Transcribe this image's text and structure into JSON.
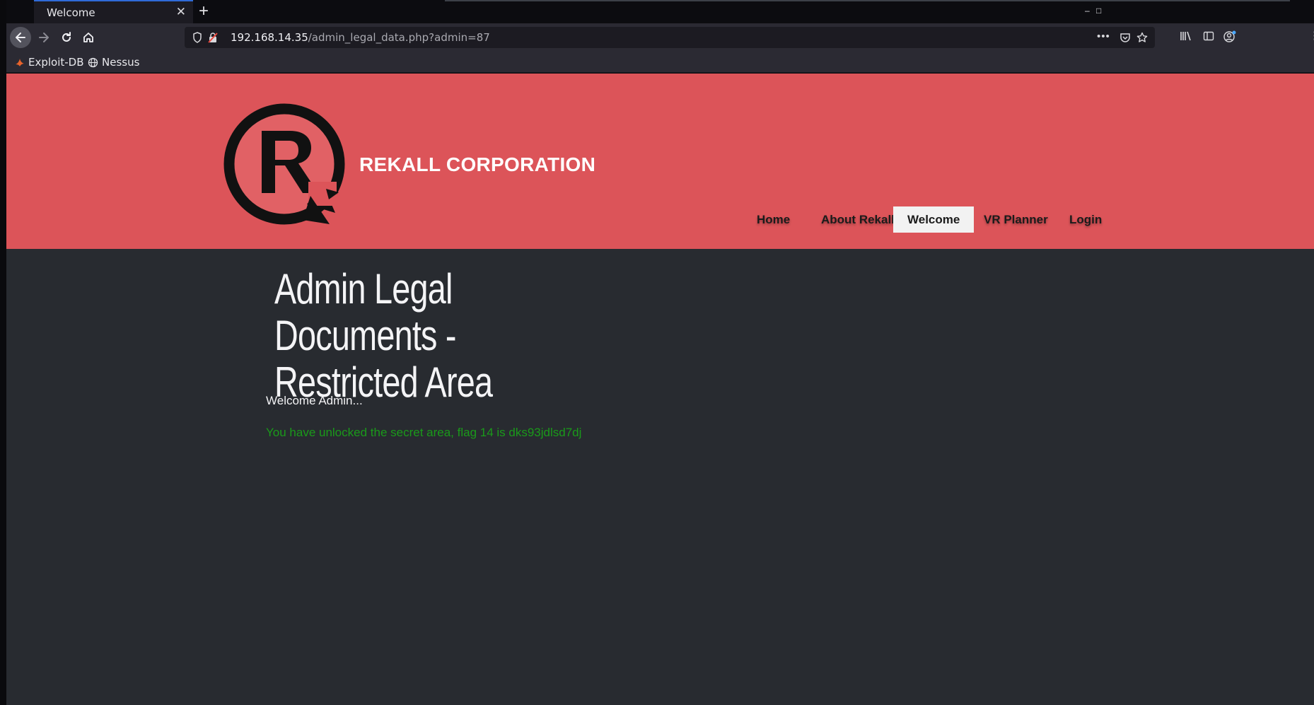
{
  "browser": {
    "tab_title": "Welcome",
    "tab_close": "✕",
    "new_tab": "+",
    "url_host": "192.168.14.35",
    "url_path": "/admin_legal_data.php?admin=87",
    "page_actions": "•••",
    "bookmarks": [
      {
        "label": "Exploit-DB"
      },
      {
        "label": "Nessus"
      }
    ],
    "window_controls": [
      "–",
      "□",
      "⋮"
    ]
  },
  "site": {
    "brand": "REKALL CORPORATION",
    "nav": [
      {
        "label": "Home",
        "active": false
      },
      {
        "label": "About Rekall",
        "active": false
      },
      {
        "label": "Welcome",
        "active": true
      },
      {
        "label": "VR Planner",
        "active": false
      },
      {
        "label": "Login",
        "active": false
      }
    ],
    "page_title": "Admin Legal Documents - Restricted Area",
    "welcome_text": "Welcome Admin...",
    "flag_text": "You have unlocked the secret area, flag 14 is dks93jdlsd7dj"
  },
  "colors": {
    "hero_bg": "#dc5459",
    "page_bg": "#282b30",
    "flag_text": "#1a9a1a",
    "tab_accent": "#2f6bd8"
  },
  "icons": [
    "back-arrow-icon",
    "forward-arrow-icon",
    "reload-icon",
    "home-icon",
    "shield-icon",
    "insecure-lock-icon",
    "pocket-icon",
    "star-icon",
    "library-icon",
    "sidebar-icon",
    "account-icon",
    "exploit-db-icon",
    "globe-icon"
  ]
}
